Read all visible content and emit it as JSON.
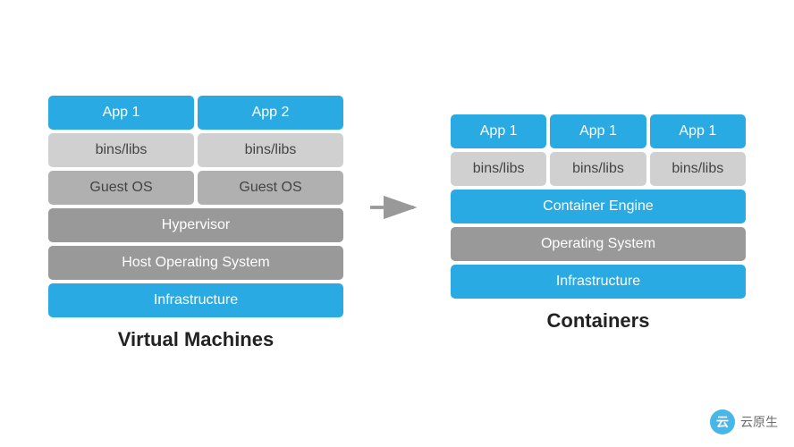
{
  "left": {
    "title": "Virtual Machines",
    "rows": [
      {
        "cells": [
          {
            "label": "App 1",
            "style": "cell-blue"
          },
          {
            "label": "App 2",
            "style": "cell-blue"
          }
        ]
      },
      {
        "cells": [
          {
            "label": "bins/libs",
            "style": "cell-lgray"
          },
          {
            "label": "bins/libs",
            "style": "cell-lgray"
          }
        ]
      },
      {
        "cells": [
          {
            "label": "Guest OS",
            "style": "cell-mgray"
          },
          {
            "label": "Guest OS",
            "style": "cell-mgray"
          }
        ]
      },
      {
        "cells": [
          {
            "label": "Hypervisor",
            "style": "cell-dgray"
          }
        ]
      },
      {
        "cells": [
          {
            "label": "Host Operating System",
            "style": "cell-dgray"
          }
        ]
      },
      {
        "cells": [
          {
            "label": "Infrastructure",
            "style": "cell-blue"
          }
        ]
      }
    ]
  },
  "right": {
    "title": "Containers",
    "rows": [
      {
        "cells": [
          {
            "label": "App 1",
            "style": "cell-blue"
          },
          {
            "label": "App 1",
            "style": "cell-blue"
          },
          {
            "label": "App 1",
            "style": "cell-blue"
          }
        ]
      },
      {
        "cells": [
          {
            "label": "bins/libs",
            "style": "cell-lgray"
          },
          {
            "label": "bins/libs",
            "style": "cell-lgray"
          },
          {
            "label": "bins/libs",
            "style": "cell-lgray"
          }
        ]
      },
      {
        "cells": [
          {
            "label": "Container Engine",
            "style": "cell-blue"
          }
        ]
      },
      {
        "cells": [
          {
            "label": "Operating System",
            "style": "cell-dgray"
          }
        ]
      },
      {
        "cells": [
          {
            "label": "Infrastructure",
            "style": "cell-blue"
          }
        ]
      }
    ]
  },
  "arrow": "→",
  "watermark": {
    "icon": "云",
    "text": "云原生"
  }
}
